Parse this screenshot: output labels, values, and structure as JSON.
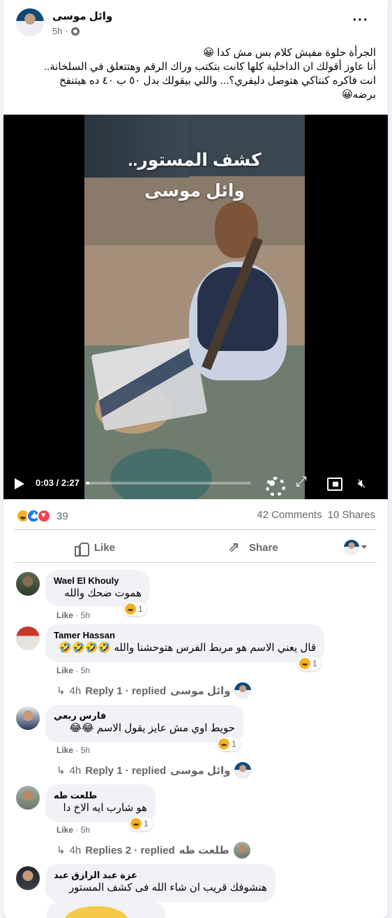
{
  "post": {
    "author": "وائل موسى",
    "time": "5h",
    "text_lines": [
      "الجرأة حلوة مفيش كلام بس مش كدا 😀",
      "أنا عاوز أقولك ان الداخلية كلها كانت بتكتب وراك الرقم وهتتعلق في السلخانة..",
      "انت فاكره كنتاكي هتوصل دليفري؟... واللي بيقولك بدل ٥٠ ب ٤٠ ده هيتنفخ",
      "برضه😀"
    ]
  },
  "video": {
    "title_line1": "كشف المستور..",
    "title_line2": "وائل موسى",
    "time_display": "0:03 / 2:27",
    "progress": 0.02
  },
  "stats": {
    "reaction_count": "39",
    "comments": "42 Comments",
    "shares": "10 Shares"
  },
  "actions": {
    "like": "Like",
    "share": "Share"
  },
  "comments": [
    {
      "name": "Wael El Khouly",
      "text": "هموت ضحك والله",
      "reaction_count": "1",
      "like": "Like",
      "time": "5h"
    },
    {
      "name": "Tamer Hassan",
      "text": "قال يعني الاسم هو مربط الفرس هتوحشنا والله 🤣🤣🤣🤣",
      "reaction_count": "1",
      "like": "Like",
      "time": "5h",
      "reply_time": "4h",
      "reply_summary": "Reply 1 · replied",
      "reply_author": "وائل موسى"
    },
    {
      "name": "فارس ربعي",
      "text": "حويط اوي مش عايز يقول الاسم 😂😂",
      "reaction_count": "1",
      "like": "Like",
      "time": "5h",
      "reply_time": "4h",
      "reply_summary": "Reply 1 · replied",
      "reply_author": "وائل موسى"
    },
    {
      "name": "طلعت طه",
      "text": "هو شارب ايه الاخ دا",
      "reaction_count": "1",
      "like": "Like",
      "time": "5h",
      "reply_time": "4h",
      "reply_summary": "Replies 2 · replied",
      "reply_author": "طلعت طه"
    },
    {
      "name": "عزة عبد الرازق عبد",
      "text": "هنشوفك قريب ان شاء الله فى كشف المستور"
    }
  ],
  "colors": {
    "text_secondary": "#65676b",
    "bubble": "#f0f2f5",
    "like_blue": "#1877f2",
    "haha_yellow": "#f7b125",
    "love_red": "#f33e58"
  }
}
